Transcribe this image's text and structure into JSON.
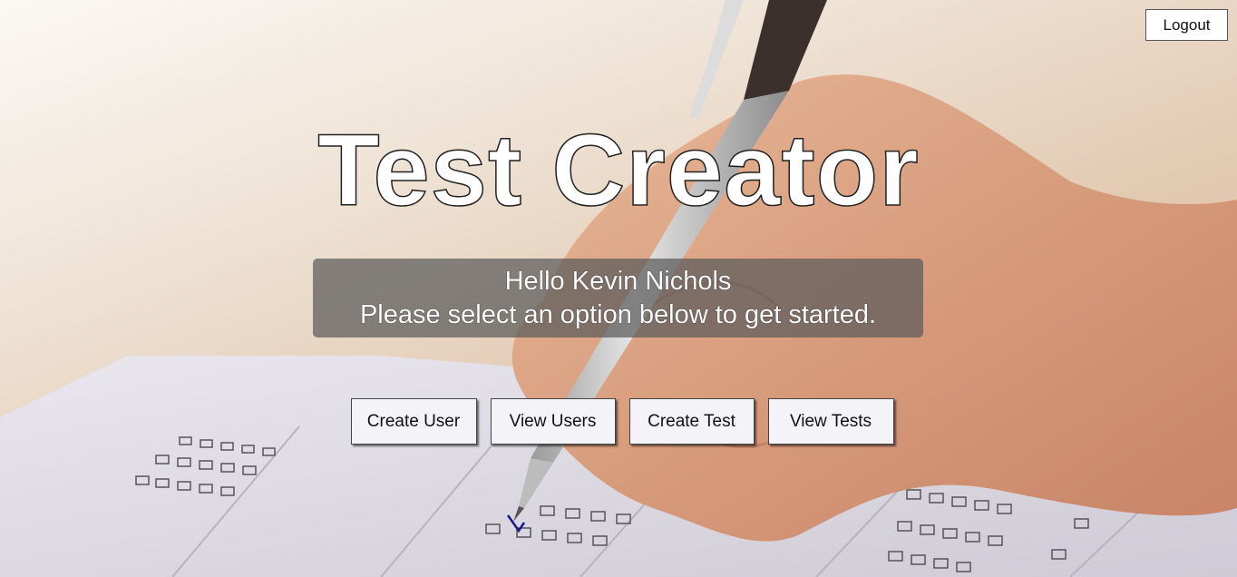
{
  "header": {
    "logout_label": "Logout"
  },
  "main": {
    "title": "Test Creator",
    "greeting_line1": "Hello Kevin Nichols",
    "greeting_line2": "Please select an option below to get started."
  },
  "actions": {
    "create_user": "Create User",
    "view_users": "View Users",
    "create_test": "Create Test",
    "view_tests": "View Tests"
  },
  "colors": {
    "overlay": "#5a5a5a",
    "button_bg": "#f3f3f8",
    "title_fill": "#ffffff"
  }
}
